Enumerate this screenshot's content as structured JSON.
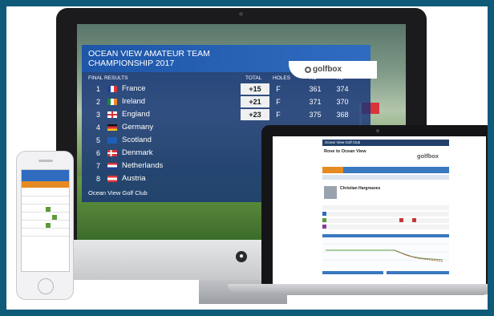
{
  "imac": {
    "title": "OCEAN VIEW AMATEUR TEAM CHAMPIONSHIP 2017",
    "brand": "golfbox",
    "section": "FINAL RESULTS",
    "columns": [
      "TOTAL",
      "HOLES",
      "R1",
      "R2"
    ],
    "rows": [
      {
        "rank": "1",
        "country": "France",
        "total": "+15",
        "holes": "F",
        "r1": "361",
        "r2": "374"
      },
      {
        "rank": "2",
        "country": "Ireland",
        "total": "+21",
        "holes": "F",
        "r1": "371",
        "r2": "370"
      },
      {
        "rank": "3",
        "country": "England",
        "total": "+23",
        "holes": "F",
        "r1": "375",
        "r2": "368"
      },
      {
        "rank": "4",
        "country": "Germany",
        "total": "",
        "holes": "",
        "r1": "",
        "r2": ""
      },
      {
        "rank": "5",
        "country": "Scotland",
        "total": "",
        "holes": "",
        "r1": "",
        "r2": ""
      },
      {
        "rank": "6",
        "country": "Denmark",
        "total": "",
        "holes": "",
        "r1": "",
        "r2": ""
      },
      {
        "rank": "7",
        "country": "Netherlands",
        "total": "",
        "holes": "",
        "r1": "",
        "r2": ""
      },
      {
        "rank": "8",
        "country": "Austria",
        "total": "",
        "holes": "",
        "r1": "",
        "r2": ""
      }
    ],
    "footer": "Ocean View Golf Club"
  },
  "laptop": {
    "bar_text": "Ocean View Golf Club",
    "page_title": "Rove to Ocean View",
    "brand": "golfbox",
    "player": "Christian Hargreaves"
  },
  "colors": {
    "header_blue": "#2f6cc0",
    "accent_orange": "#e68a22",
    "panel_blue": "#163478"
  }
}
